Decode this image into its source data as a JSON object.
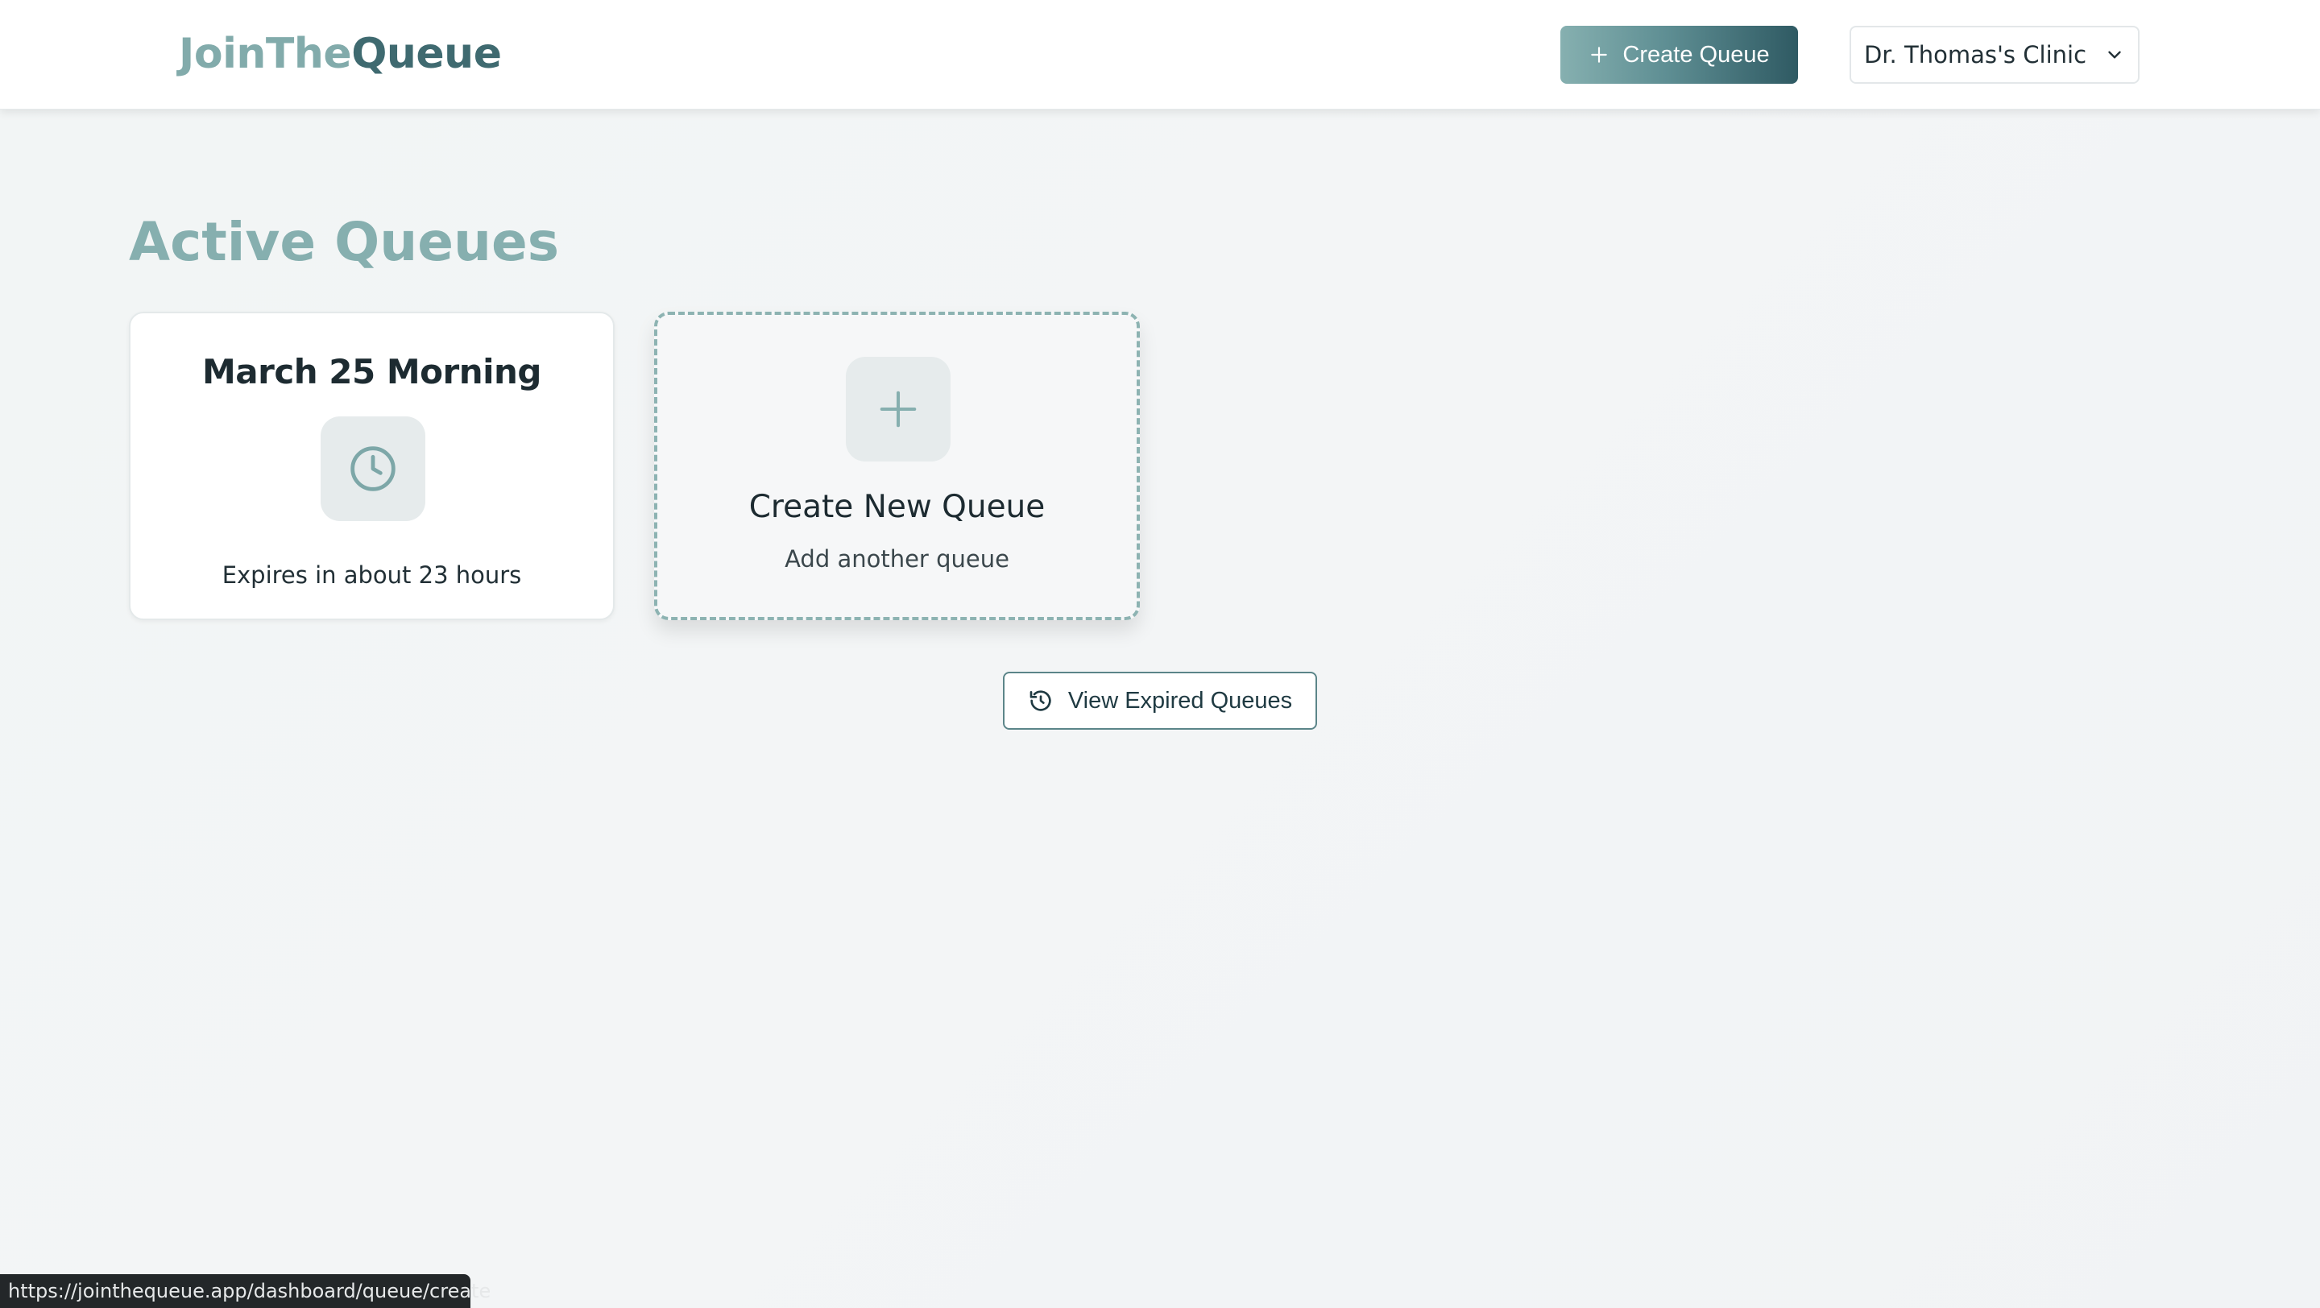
{
  "header": {
    "logo_part1": "JoinThe",
    "logo_part2": "Queue",
    "create_queue_label": "Create Queue",
    "clinic_name": "Dr. Thomas's Clinic"
  },
  "main": {
    "title": "Active Queues",
    "queues": [
      {
        "name": "March 25 Morning",
        "expiry": "Expires in about 23 hours",
        "icon": "clock-icon"
      }
    ],
    "new_queue_card": {
      "title": "Create New Queue",
      "subtitle": "Add another queue",
      "icon": "plus-icon"
    },
    "view_expired_label": "View Expired Queues"
  },
  "status_bar": {
    "url": "https://jointhequeue.app/dashboard/queue/create"
  },
  "colors": {
    "accent_light": "#86afaf",
    "accent_dark": "#2f5a63",
    "dashed_border": "#8db3b2"
  }
}
